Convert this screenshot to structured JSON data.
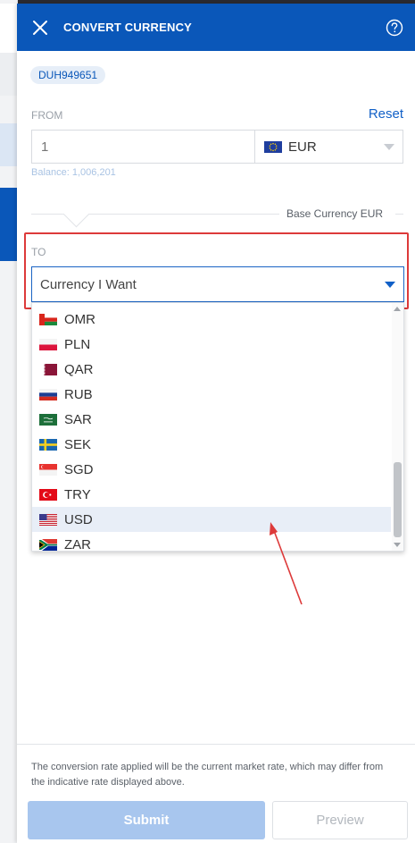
{
  "header": {
    "title": "CONVERT CURRENCY",
    "close_icon": "close-icon",
    "help_icon": "question-circle-icon"
  },
  "account": {
    "id": "DUH949651"
  },
  "from": {
    "label": "FROM",
    "reset_label": "Reset",
    "amount_placeholder": "1",
    "currency": "EUR",
    "currency_flag": "eu-flag-icon",
    "balance": "Balance: 1,006,201"
  },
  "base_currency": "Base Currency EUR",
  "to": {
    "label": "TO",
    "placeholder": "Currency I Want"
  },
  "dropdown": {
    "items": [
      {
        "code": "OMR",
        "flag": "oman-flag-icon"
      },
      {
        "code": "PLN",
        "flag": "poland-flag-icon"
      },
      {
        "code": "QAR",
        "flag": "qatar-flag-icon"
      },
      {
        "code": "RUB",
        "flag": "russia-flag-icon"
      },
      {
        "code": "SAR",
        "flag": "saudi-flag-icon"
      },
      {
        "code": "SEK",
        "flag": "sweden-flag-icon"
      },
      {
        "code": "SGD",
        "flag": "singapore-flag-icon"
      },
      {
        "code": "TRY",
        "flag": "turkey-flag-icon"
      },
      {
        "code": "USD",
        "flag": "usa-flag-icon"
      },
      {
        "code": "ZAR",
        "flag": "south-africa-flag-icon"
      }
    ],
    "hovered": "USD"
  },
  "footer": {
    "disclaimer": "The conversion rate applied will be the current market rate, which may differ from the indicative rate displayed above.",
    "submit_label": "Submit",
    "preview_label": "Preview"
  },
  "colors": {
    "brand": "#0a57b9",
    "link": "#1160c7",
    "highlight": "#dd3a3a",
    "submit_disabled": "#a8c6ee"
  }
}
